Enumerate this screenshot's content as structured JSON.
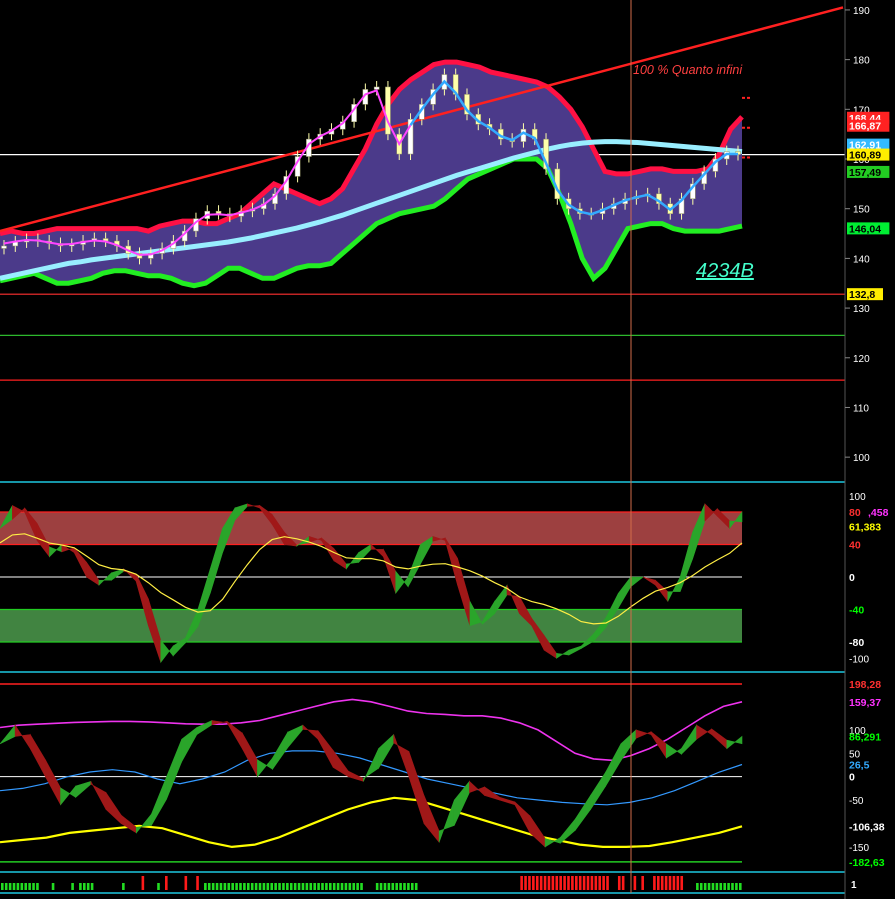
{
  "chart_data": [
    {
      "type": "candlestick",
      "panel": "price",
      "yticks": [
        190,
        180,
        170,
        160,
        150,
        140,
        130,
        120,
        110,
        100
      ],
      "ylim": [
        95,
        192
      ],
      "annotations": {
        "strategy": "100 % Quanto infini",
        "code": "4234B"
      },
      "trendline": {
        "color": "#ff2020",
        "from": 145.5,
        "to": 190.5
      },
      "levels": [
        {
          "label": "",
          "value": 160.89,
          "color": "#ffffff"
        },
        {
          "label": "132,8",
          "value": 132.8,
          "color": "#ff3030"
        },
        {
          "label": "",
          "value": 124.5,
          "color": "#2db82d"
        },
        {
          "label": "",
          "value": 115.5,
          "color": "#ff2020"
        }
      ],
      "badges": [
        {
          "text": "168,44",
          "value": 168.3,
          "bg": "#ff2222",
          "fg": "#ffffff"
        },
        {
          "text": "166,87",
          "value": 166.7,
          "bg": "#ff2222",
          "fg": "#ffffff"
        },
        {
          "text": "162,91",
          "value": 162.9,
          "bg": "#33bbff",
          "fg": "#ffffff"
        },
        {
          "text": "160,89",
          "value": 160.89,
          "bg": "#ffee00",
          "fg": "#000000"
        },
        {
          "text": "157,49",
          "value": 157.4,
          "bg": "#22cc22",
          "fg": "#000000"
        },
        {
          "text": "146,04",
          "value": 146.04,
          "bg": "#00ee33",
          "fg": "#000000"
        },
        {
          "text": "132,8",
          "value": 132.8,
          "bg": "#ffee00",
          "fg": "#000000"
        }
      ],
      "bands": {
        "upper": [
          145,
          145.5,
          145,
          145,
          145.5,
          146,
          146,
          146,
          146,
          146,
          146,
          146,
          146,
          145.5,
          146.5,
          147,
          147.5,
          147.5,
          147,
          147,
          148,
          149,
          151,
          153,
          155,
          154,
          153,
          152,
          151,
          152,
          154,
          158,
          162,
          167,
          171,
          174,
          176,
          177.5,
          179,
          179.5,
          179.5,
          179,
          178.5,
          177.5,
          177,
          176.5,
          176,
          175.5,
          174.5,
          172.5,
          170,
          166.5,
          162,
          157.5,
          157,
          157,
          157.5,
          158,
          158,
          157.5,
          157.5,
          157.5,
          158,
          161,
          166,
          168.5
        ],
        "lower": [
          135.5,
          136,
          136.5,
          137,
          136,
          135,
          135,
          135.5,
          136,
          137,
          137.5,
          137.5,
          137,
          136.5,
          136.5,
          136,
          135,
          134.5,
          135,
          136.5,
          138,
          138,
          137,
          136,
          136,
          137,
          138,
          138.5,
          138.5,
          139,
          141,
          143,
          145,
          147,
          148,
          149,
          149.5,
          150,
          150.5,
          152,
          154,
          156,
          157,
          158,
          159,
          160,
          160,
          160,
          158,
          153,
          147,
          140,
          136,
          138,
          142,
          146,
          146.5,
          147,
          147,
          146,
          145.5,
          145.5,
          145.5,
          145.5,
          146,
          146.5
        ]
      },
      "ma_long": [
        136,
        136.5,
        137,
        137.5,
        138,
        138.5,
        139,
        139.3,
        139.7,
        140,
        140.3,
        140.6,
        140.9,
        141.2,
        141.5,
        141.8,
        142.1,
        142.4,
        142.7,
        143,
        143.3,
        143.7,
        144.1,
        144.6,
        145.1,
        145.6,
        146.1,
        146.7,
        147.3,
        148,
        148.7,
        149.5,
        150.3,
        151.1,
        151.9,
        152.7,
        153.5,
        154.3,
        155.1,
        155.9,
        156.7,
        157.4,
        158.1,
        158.8,
        159.5,
        160.2,
        160.8,
        161.4,
        162,
        162.5,
        162.9,
        163.2,
        163.4,
        163.5,
        163.5,
        163.4,
        163.3,
        163.1,
        162.9,
        162.7,
        162.5,
        162.3,
        162.1,
        161.9,
        161.7,
        161.5
      ],
      "close": [
        142.5,
        143.3,
        143.8,
        143.5,
        143,
        142.5,
        142.8,
        143.5,
        144,
        143.5,
        142.5,
        141,
        140,
        141,
        142,
        143.5,
        145.5,
        148,
        149.5,
        149,
        148.5,
        149.5,
        150,
        151,
        153,
        156.5,
        160.5,
        164,
        165,
        166,
        167.5,
        171,
        174,
        174.5,
        165,
        161,
        168,
        171,
        174,
        177,
        173,
        169,
        167,
        166,
        164,
        163.5,
        166,
        164,
        158,
        152,
        150,
        149,
        149,
        150,
        151,
        152,
        152.5,
        153,
        151,
        149,
        152,
        155,
        157.5,
        160,
        161.5,
        160.9
      ],
      "ma_fast": [
        143,
        143.4,
        143.7,
        143.6,
        143.2,
        142.8,
        142.9,
        143.3,
        143.6,
        143.4,
        142.7,
        141.6,
        140.7,
        140.8,
        141.6,
        143,
        145,
        147.3,
        148.8,
        148.9,
        148.7,
        149.2,
        149.8,
        150.8,
        152.6,
        155.6,
        159.5,
        163,
        164.6,
        165.7,
        167.2,
        170,
        173,
        173.8,
        167.5,
        163,
        166.8,
        170,
        173,
        175.6,
        173.3,
        169.8,
        167.6,
        166.3,
        164.6,
        163.8,
        165.3,
        164.2,
        159.2,
        153.8,
        150.8,
        149.4,
        148.9,
        149.7,
        150.7,
        151.7,
        152.3,
        152.8,
        151.5,
        149.8,
        151.7,
        154.4,
        156.9,
        159.4,
        161,
        161
      ]
    },
    {
      "type": "area",
      "panel": "oscillator",
      "yticks": [
        100,
        80,
        40,
        0,
        -40,
        -80,
        -100
      ],
      "ylim": [
        -112,
        112
      ],
      "zones": [
        {
          "from": 40,
          "to": 80,
          "color": "#b84b4b"
        },
        {
          "from": -80,
          "to": -40,
          "color": "#4c9b4c"
        }
      ],
      "badges": [
        {
          "text": "80",
          "value": 80,
          "bg": "#000000",
          "fg": "#ff3030"
        },
        {
          "text": ",458",
          "value": 80,
          "bg": "#000000",
          "fg": "#ff33ff"
        },
        {
          "text": "61,383",
          "value": 62,
          "bg": "#000000",
          "fg": "#ffff00"
        },
        {
          "text": "40",
          "value": 40,
          "bg": "#000000",
          "fg": "#ff3030"
        },
        {
          "text": "0",
          "value": 0,
          "bg": "#000000",
          "fg": "#ffffff"
        },
        {
          "text": "-40",
          "value": -40,
          "bg": "#000000",
          "fg": "#00ff00"
        },
        {
          "text": "-80",
          "value": -80,
          "bg": "#000000",
          "fg": "#ffffff"
        }
      ],
      "fast": [
        60,
        88,
        80,
        45,
        25,
        40,
        30,
        0,
        -10,
        5,
        10,
        -5,
        -60,
        -105,
        -85,
        -75,
        -40,
        10,
        60,
        85,
        90,
        85,
        65,
        40,
        38,
        50,
        45,
        20,
        10,
        30,
        40,
        25,
        -20,
        0,
        40,
        50,
        45,
        -10,
        -60,
        -55,
        -30,
        -10,
        -45,
        -60,
        -90,
        -100,
        -90,
        -85,
        -70,
        -50,
        -20,
        0,
        0,
        -10,
        -30,
        0,
        55,
        90,
        75,
        60,
        80
      ]
    },
    {
      "type": "line",
      "panel": "oscillator2",
      "yticks": [
        100,
        50,
        0,
        -50,
        -150
      ],
      "ylim": [
        -195,
        215
      ],
      "badges": [
        {
          "text": "198,28",
          "value": 198,
          "bg": "#000000",
          "fg": "#ff3030"
        },
        {
          "text": "159,37",
          "value": 159,
          "bg": "#000000",
          "fg": "#ff33ff"
        },
        {
          "text": "86,291",
          "value": 86,
          "bg": "#000000",
          "fg": "#00ff00"
        },
        {
          "text": "26,5",
          "value": 26,
          "bg": "#000000",
          "fg": "#33aaff"
        },
        {
          "text": "0",
          "value": 0,
          "bg": "#000000",
          "fg": "#ffffff"
        },
        {
          "text": "-106,38",
          "value": -106,
          "bg": "#000000",
          "fg": "#ffffff"
        },
        {
          "text": "-182,63",
          "value": -182,
          "bg": "#000000",
          "fg": "#00ff00"
        }
      ],
      "levels": [
        {
          "value": 198,
          "color": "#ff2020"
        },
        {
          "value": -182,
          "color": "#22cc22"
        }
      ],
      "magenta": [
        105,
        110,
        112,
        114,
        116,
        117,
        118,
        118,
        117,
        115,
        113,
        112,
        112,
        115,
        120,
        130,
        140,
        150,
        160,
        165,
        160,
        150,
        140,
        135,
        133,
        130,
        130,
        125,
        115,
        100,
        75,
        50,
        38,
        35,
        45,
        60,
        80,
        105,
        130,
        150,
        160
      ],
      "blue": [
        -30,
        -25,
        -15,
        0,
        10,
        15,
        10,
        -5,
        -15,
        -5,
        10,
        35,
        50,
        55,
        55,
        50,
        40,
        25,
        10,
        -5,
        -15,
        -25,
        -35,
        -45,
        -50,
        -55,
        -58,
        -60,
        -55,
        -45,
        -30,
        -10,
        10,
        26
      ],
      "yellow": [
        -140,
        -135,
        -130,
        -120,
        -115,
        -110,
        -105,
        -110,
        -125,
        -140,
        -150,
        -145,
        -130,
        -110,
        -90,
        -70,
        -55,
        -45,
        -50,
        -65,
        -80,
        -95,
        -110,
        -125,
        -135,
        -145,
        -150,
        -150,
        -148,
        -140,
        -130,
        -120,
        -106
      ],
      "fast": [
        70,
        110,
        60,
        0,
        -60,
        -20,
        -10,
        -70,
        -100,
        -120,
        -80,
        0,
        80,
        105,
        120,
        115,
        60,
        0,
        40,
        95,
        110,
        80,
        20,
        0,
        -10,
        60,
        90,
        0,
        -100,
        -140,
        -50,
        -10,
        -40,
        -50,
        -60,
        -120,
        -150,
        -130,
        -90,
        -40,
        10,
        70,
        100,
        90,
        40,
        60,
        110,
        90,
        60,
        86
      ]
    },
    {
      "type": "bar",
      "panel": "signal",
      "badges": [
        {
          "text": "1",
          "value": 0,
          "bg": "#000000",
          "fg": "#ffffff"
        }
      ],
      "colors": [
        "g",
        "g",
        "g",
        "g",
        "g",
        "g",
        "g",
        "g",
        "g",
        "g",
        "",
        "",
        "",
        "g",
        "",
        "",
        "",
        "",
        "g",
        "",
        "g",
        "g",
        "g",
        "g",
        "",
        "",
        "",
        "",
        "",
        "",
        "",
        "g",
        "",
        "",
        "",
        "",
        "r",
        "",
        "",
        "",
        "g",
        "",
        "r",
        "",
        "",
        "",
        "",
        "r",
        "",
        "",
        "r",
        "",
        "g",
        "g",
        "g",
        "g",
        "g",
        "g",
        "g",
        "g",
        "g",
        "g",
        "g",
        "g",
        "g",
        "g",
        "g",
        "g",
        "g",
        "g",
        "g",
        "g",
        "g",
        "g",
        "g",
        "g",
        "g",
        "g",
        "g",
        "g",
        "g",
        "g",
        "g",
        "g",
        "g",
        "g",
        "g",
        "g",
        "g",
        "g",
        "g",
        "g",
        "g",
        "",
        "",
        "",
        "g",
        "g",
        "g",
        "g",
        "g",
        "g",
        "g",
        "g",
        "g",
        "g",
        "g",
        "",
        "",
        "",
        "",
        "",
        "",
        "",
        "",
        "",
        "",
        "",
        "",
        "",
        "",
        "",
        "",
        "",
        "",
        "",
        "",
        "",
        "",
        "",
        "",
        "",
        "",
        "r",
        "r",
        "r",
        "r",
        "r",
        "r",
        "r",
        "r",
        "r",
        "r",
        "r",
        "r",
        "r",
        "r",
        "r",
        "r",
        "r",
        "r",
        "r",
        "r",
        "r",
        "r",
        "r",
        "",
        "",
        "r",
        "r",
        "",
        "",
        "r",
        "",
        "r",
        "",
        "",
        "r",
        "r",
        "r",
        "r",
        "r",
        "r",
        "r",
        "r",
        "",
        "",
        "",
        "g",
        "g",
        "g",
        "g",
        "g",
        "g",
        "g",
        "g",
        "g",
        "g",
        "g",
        "g"
      ]
    }
  ]
}
